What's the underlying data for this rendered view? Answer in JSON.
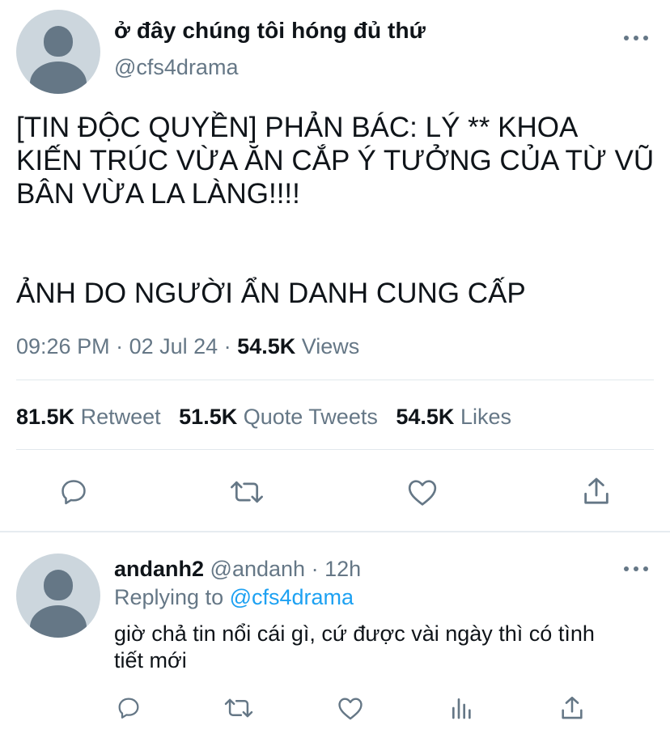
{
  "tweet": {
    "display_name": "ở đây chúng tôi hóng đủ thứ",
    "handle": "@cfs4drama",
    "text_lines": [
      "[TIN ĐỘC QUYỀN] PHẢN BÁC: LÝ ** KHOA",
      "KIẾN TRÚC VỪA ĂN CẮP Ý TƯỞNG CỦA TỪ VŨ",
      "BÂN VỪA LA LÀNG!!!!",
      "ẢNH DO NGƯỜI ẨN DANH CUNG CẤP"
    ],
    "time": "09:26 PM",
    "date": "02 Jul 24",
    "views_count": "54.5K",
    "views_label": "Views",
    "retweets_count": "81.5K",
    "retweets_label": "Retweet",
    "quotes_count": "51.5K",
    "quotes_label": "Quote Tweets",
    "likes_count": "54.5K",
    "likes_label": "Likes",
    "actions": [
      "reply-icon",
      "retweet-icon",
      "like-icon",
      "share-icon"
    ]
  },
  "reply": {
    "display_name": "andanh2",
    "handle": "@andanh",
    "age": "12h",
    "replying_prefix": "Replying to",
    "replying_to": "@cfs4drama",
    "text_lines": [
      "giờ chả tin nổi cái gì, cứ được vài ngày thì có tình",
      "tiết mới"
    ],
    "actions": [
      "reply-icon",
      "retweet-icon",
      "like-icon",
      "analytics-icon",
      "share-icon"
    ]
  },
  "colors": {
    "text_primary": "#0f1419",
    "text_secondary": "#657786",
    "link": "#1da1f2",
    "avatar_bg": "#ccd6dd",
    "divider": "#e1e8ed"
  }
}
